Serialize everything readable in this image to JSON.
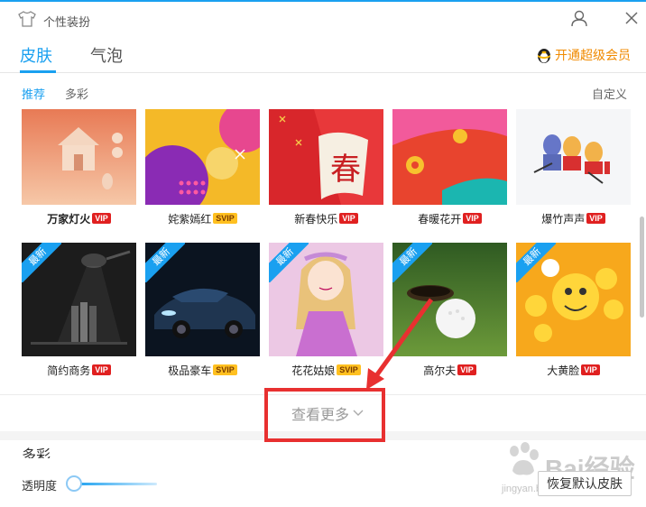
{
  "window": {
    "title": "个性装扮"
  },
  "tabs": [
    {
      "label": "皮肤"
    },
    {
      "label": "气泡"
    }
  ],
  "vip_link": {
    "label": "开通超级会员"
  },
  "subtabs": [
    {
      "label": "推荐"
    },
    {
      "label": "多彩"
    }
  ],
  "custom_label": "自定义",
  "new_ribbon": "最新",
  "skins": [
    {
      "name": "万家灯火",
      "badge": "VIP"
    },
    {
      "name": "姹紫嫣红",
      "badge": "SVIP"
    },
    {
      "name": "新春快乐",
      "badge": "VIP"
    },
    {
      "name": "春暖花开",
      "badge": "VIP"
    },
    {
      "name": "爆竹声声",
      "badge": "VIP"
    },
    {
      "name": "简约商务",
      "badge": "VIP"
    },
    {
      "name": "极品豪车",
      "badge": "SVIP"
    },
    {
      "name": "花花姑娘",
      "badge": "SVIP"
    },
    {
      "name": "高尔夫",
      "badge": "VIP"
    },
    {
      "name": "大黄脸",
      "badge": "VIP"
    }
  ],
  "view_more": {
    "label": "查看更多"
  },
  "section_title": "多彩",
  "opacity": {
    "label": "透明度",
    "value_fraction": 0.0
  },
  "restore_button": {
    "label": "恢复默认皮肤"
  },
  "watermark": {
    "text": "Bai经验",
    "sub": "jingyan.baidu.com"
  },
  "colors": {
    "accent": "#1aa0f0",
    "vip_orange": "#f08a00",
    "highlight_red": "#e83030"
  }
}
